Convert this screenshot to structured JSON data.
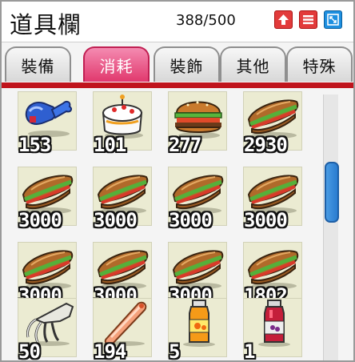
{
  "window": {
    "title": "道具欄",
    "capacity": "388/500"
  },
  "title_buttons": [
    {
      "name": "up-arrow-icon",
      "color": "#e23b3b"
    },
    {
      "name": "menu-icon",
      "color": "#e23b3b"
    },
    {
      "name": "expand-icon",
      "color": "#1d8fe0"
    }
  ],
  "tabs": [
    {
      "label": "裝備",
      "active": false
    },
    {
      "label": "消耗",
      "active": true
    },
    {
      "label": "裝飾",
      "active": false
    },
    {
      "label": "其他",
      "active": false
    },
    {
      "label": "特殊",
      "active": false
    }
  ],
  "colors": {
    "active_tab": "#e1386d",
    "accent_line": "#c0141c",
    "scroll_thumb": "#2a7cd0"
  },
  "items": [
    {
      "icon": "blue-drumstick-icon",
      "qty": "153"
    },
    {
      "icon": "cake-icon",
      "qty": "101"
    },
    {
      "icon": "hamburger-icon",
      "qty": "277"
    },
    {
      "icon": "sandwich-icon",
      "qty": "2930"
    },
    {
      "icon": "sandwich-icon",
      "qty": "3000"
    },
    {
      "icon": "sandwich-icon",
      "qty": "3000"
    },
    {
      "icon": "sandwich-icon",
      "qty": "3000"
    },
    {
      "icon": "sandwich-icon",
      "qty": "3000"
    },
    {
      "icon": "sandwich-icon",
      "qty": "3000"
    },
    {
      "icon": "sandwich-icon",
      "qty": "3000"
    },
    {
      "icon": "sandwich-icon",
      "qty": "3000"
    },
    {
      "icon": "sandwich-icon",
      "qty": "1802"
    },
    {
      "icon": "squid-icon",
      "qty": "50"
    },
    {
      "icon": "sausage-icon",
      "qty": "194"
    },
    {
      "icon": "orange-juice-icon",
      "qty": "5"
    },
    {
      "icon": "red-potion-icon",
      "qty": "1"
    }
  ]
}
